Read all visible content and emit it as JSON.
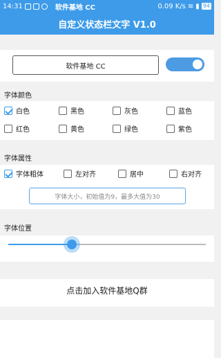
{
  "statusbar": {
    "time": "14:31",
    "title": "软件基地  CC",
    "net_speed": "0.09 K/s",
    "battery": "94"
  },
  "appbar": {
    "title": "自定义状态栏文字 V1.0"
  },
  "name_field": {
    "value": "软件基地  CC"
  },
  "toggle": {
    "on": true
  },
  "font_color": {
    "label": "字体颜色",
    "options": [
      {
        "label": "白色",
        "checked": true
      },
      {
        "label": "黑色",
        "checked": false
      },
      {
        "label": "灰色",
        "checked": false
      },
      {
        "label": "蓝色",
        "checked": false
      },
      {
        "label": "红色",
        "checked": false
      },
      {
        "label": "黄色",
        "checked": false
      },
      {
        "label": "绿色",
        "checked": false
      },
      {
        "label": "紫色",
        "checked": false
      }
    ]
  },
  "font_attr": {
    "label": "字体属性",
    "options": [
      {
        "label": "字体粗体",
        "checked": true
      },
      {
        "label": "左对齐",
        "checked": false
      },
      {
        "label": "居中",
        "checked": false
      },
      {
        "label": "右对齐",
        "checked": false
      }
    ],
    "size_placeholder": "字体大小，初始值为9，最多大值为30"
  },
  "font_position": {
    "label": "字体位置",
    "value": 0.32
  },
  "qq_link": "点击加入软件基地Q群",
  "colors": {
    "accent": "#3d9be9",
    "background": "#f1f1f1"
  }
}
